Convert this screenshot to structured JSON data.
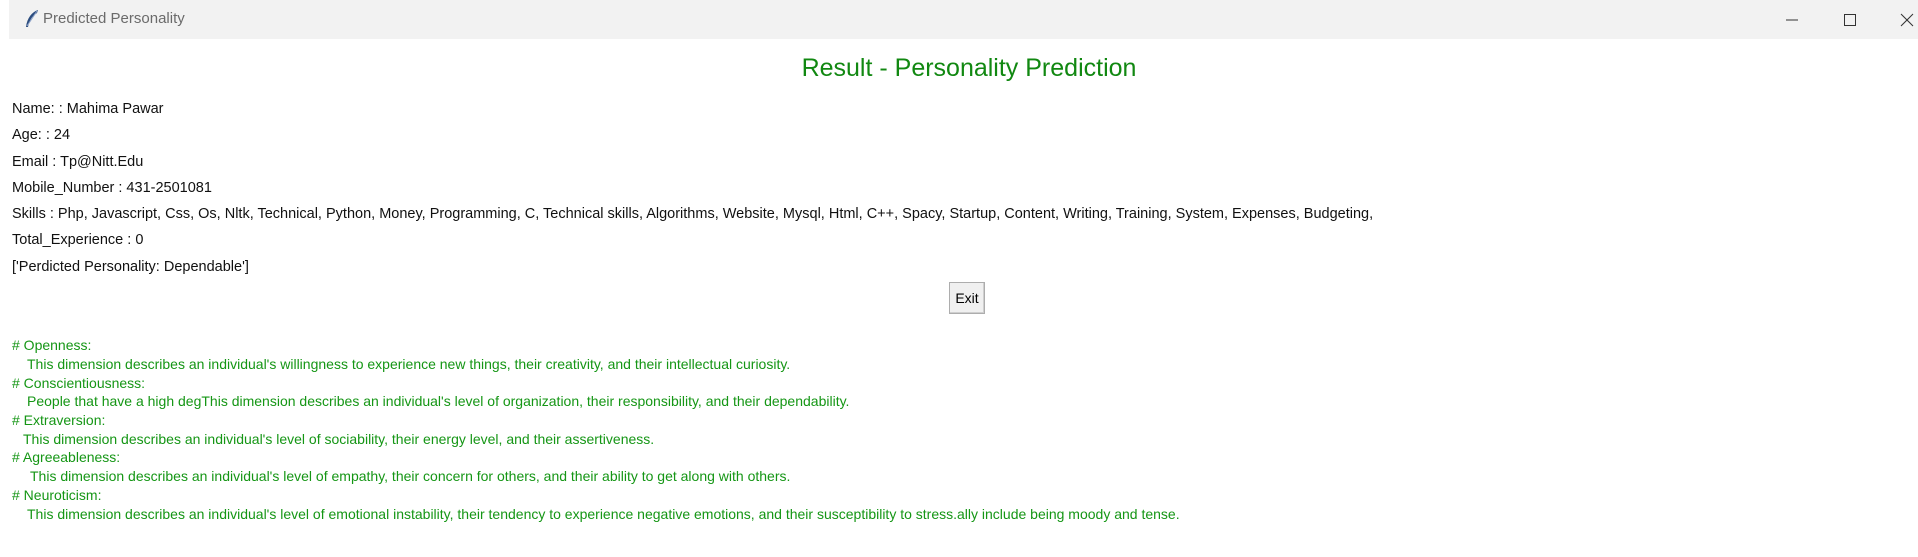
{
  "window": {
    "title": "Predicted Personality",
    "icon": "feather-icon"
  },
  "heading": "Result - Personality Prediction",
  "info": {
    "name": "Name: : Mahima Pawar",
    "age": "Age: : 24",
    "email": "Email : Tp@Nitt.Edu",
    "mobile": "Mobile_Number : 431-2501081",
    "skills": "Skills : Php, Javascript, Css, Os, Nltk, Technical, Python, Money, Programming, C, Technical skills, Algorithms, Website, Mysql, Html, C++, Spacy, Startup, Content, Writing, Training, System, Expenses, Budgeting,",
    "experience": "Total_Experience : 0",
    "prediction": "['Perdicted Personality: Dependable']"
  },
  "exit_label": "Exit",
  "traits": [
    {
      "title": "# Openness:",
      "text": "This dimension describes an individual's willingness to experience new things, their creativity, and their intellectual curiosity."
    },
    {
      "title": "# Conscientiousness:",
      "text": "People that have a high degThis dimension describes an individual's level of organization, their responsibility, and their dependability."
    },
    {
      "title": "# Extraversion:",
      "text": "This dimension describes an individual's level of sociability, their energy level, and their assertiveness."
    },
    {
      "title": "# Agreeableness:",
      "text": "This dimension describes an individual's level of empathy, their concern for others, and their ability to get along with others."
    },
    {
      "title": "# Neuroticism:",
      "text": "This dimension describes an individual's level of emotional instability, their tendency to experience negative emotions, and their susceptibility to stress.ally include being moody and tense."
    }
  ],
  "colors": {
    "heading": "#118811",
    "trait_text": "#159615"
  }
}
